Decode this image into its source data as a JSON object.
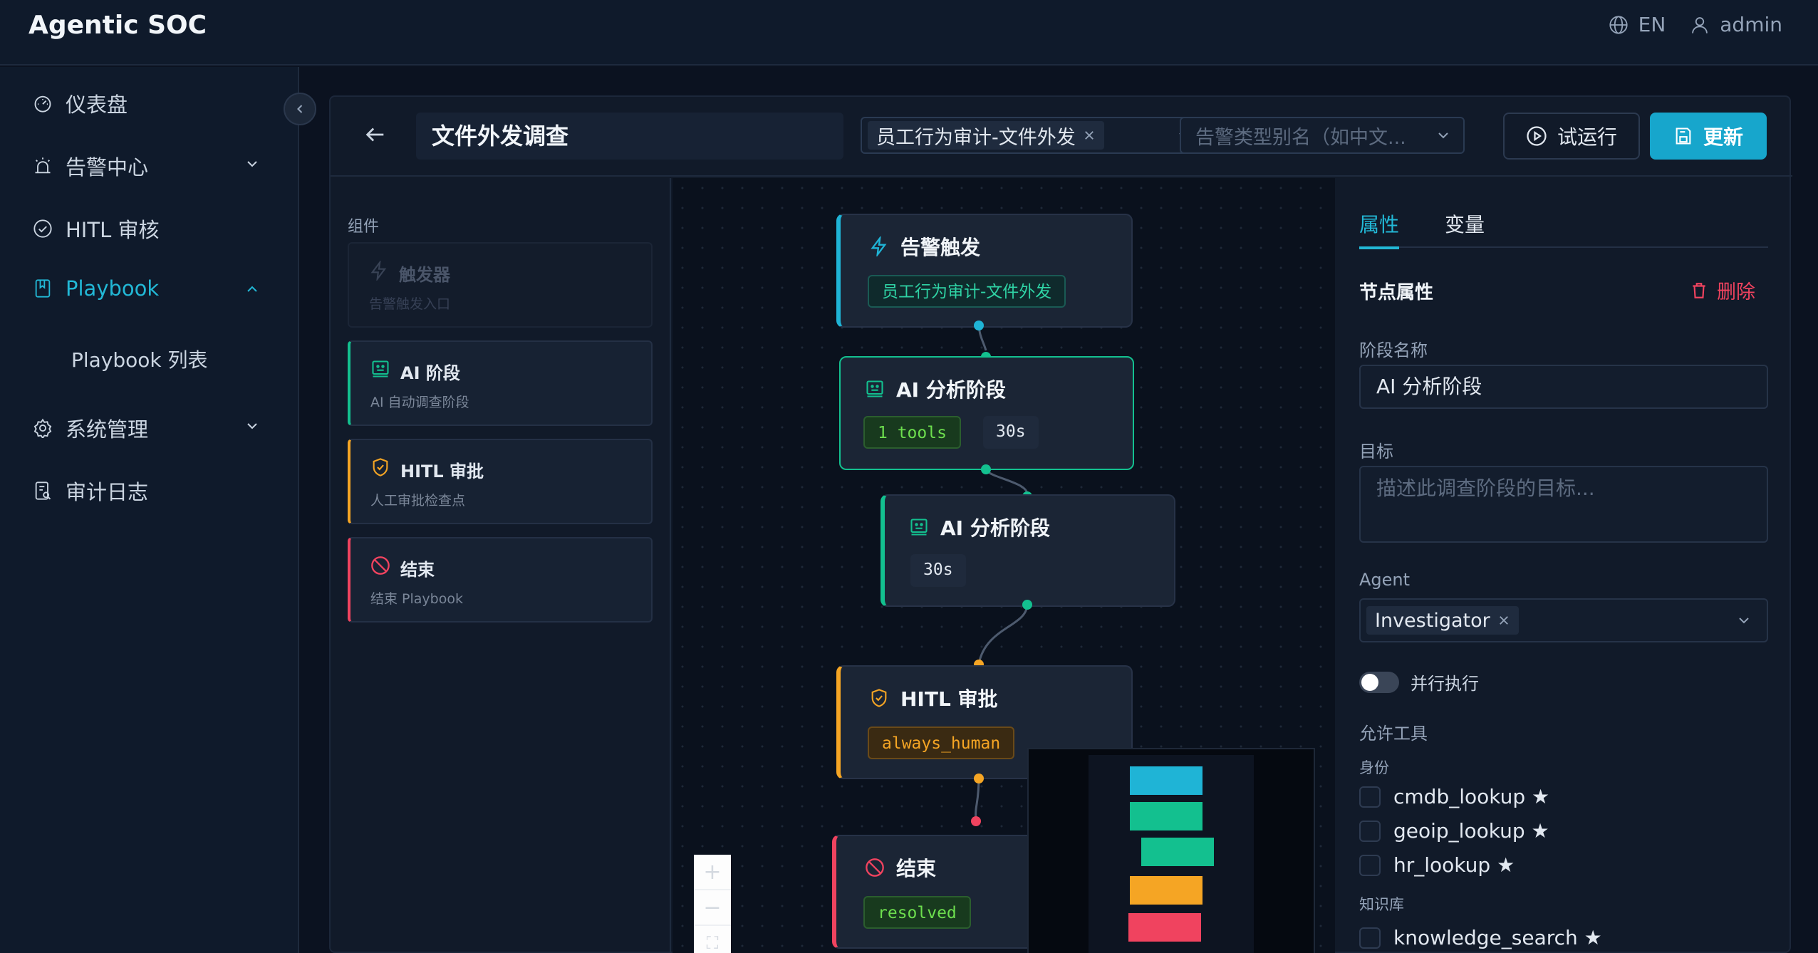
{
  "app": {
    "title": "Agentic SOC"
  },
  "topbar": {
    "language": "EN",
    "user": "admin"
  },
  "sidebar": {
    "items": [
      {
        "label": "仪表盘",
        "icon": "dashboard-icon"
      },
      {
        "label": "告警中心",
        "icon": "alarm-icon"
      },
      {
        "label": "HITL 审核",
        "icon": "check-circle-icon"
      },
      {
        "label": "Playbook",
        "icon": "book-icon"
      },
      {
        "label": "系统管理",
        "icon": "gear-icon"
      },
      {
        "label": "审计日志",
        "icon": "audit-log-icon"
      }
    ],
    "subitems": [
      {
        "label": "Playbook 列表"
      }
    ]
  },
  "header": {
    "playbook_name": "文件外发调查",
    "alert_type_tag": "员工行为审计-文件外发",
    "alias_placeholder": "告警类型别名（如中文...",
    "dry_run_label": "试运行",
    "update_label": "更新"
  },
  "components": {
    "title": "组件",
    "items": [
      {
        "name": "触发器",
        "desc": "告警触发入口"
      },
      {
        "name": "AI 阶段",
        "desc": "AI 自动调查阶段"
      },
      {
        "name": "HITL 审批",
        "desc": "人工审批检查点"
      },
      {
        "name": "结束",
        "desc": "结束 Playbook"
      }
    ]
  },
  "canvas": {
    "nodes": [
      {
        "title": "告警触发",
        "chip": "员工行为审计-文件外发"
      },
      {
        "title": "AI 分析阶段",
        "tools": "1 tools",
        "timeout": "30s"
      },
      {
        "title": "AI 分析阶段",
        "timeout": "30s"
      },
      {
        "title": "HITL 审批",
        "chip": "always_human"
      },
      {
        "title": "结束",
        "chip": "resolved"
      }
    ],
    "zoom": {
      "in": "+",
      "out": "−",
      "fit": "⛶"
    }
  },
  "properties": {
    "tab_props": "属性",
    "tab_vars": "变量",
    "section_title": "节点属性",
    "delete_label": "删除",
    "stage_name_label": "阶段名称",
    "stage_name_value": "AI 分析阶段",
    "goal_label": "目标",
    "goal_placeholder": "描述此调查阶段的目标...",
    "agent_label": "Agent",
    "agent_value": "Investigator",
    "parallel_label": "并行执行",
    "allowed_tools_label": "允许工具",
    "group_identity": "身份",
    "tools_identity": [
      "cmdb_lookup ★",
      "geoip_lookup ★",
      "hr_lookup ★"
    ],
    "group_knowledge": "知识库",
    "tools_knowledge": [
      "knowledge_search ★"
    ]
  },
  "colors": {
    "accent": "#22b8d6",
    "trigger": "#1fb4d6",
    "ai": "#13c08f",
    "hitl": "#f5a524",
    "end": "#f0435f"
  }
}
